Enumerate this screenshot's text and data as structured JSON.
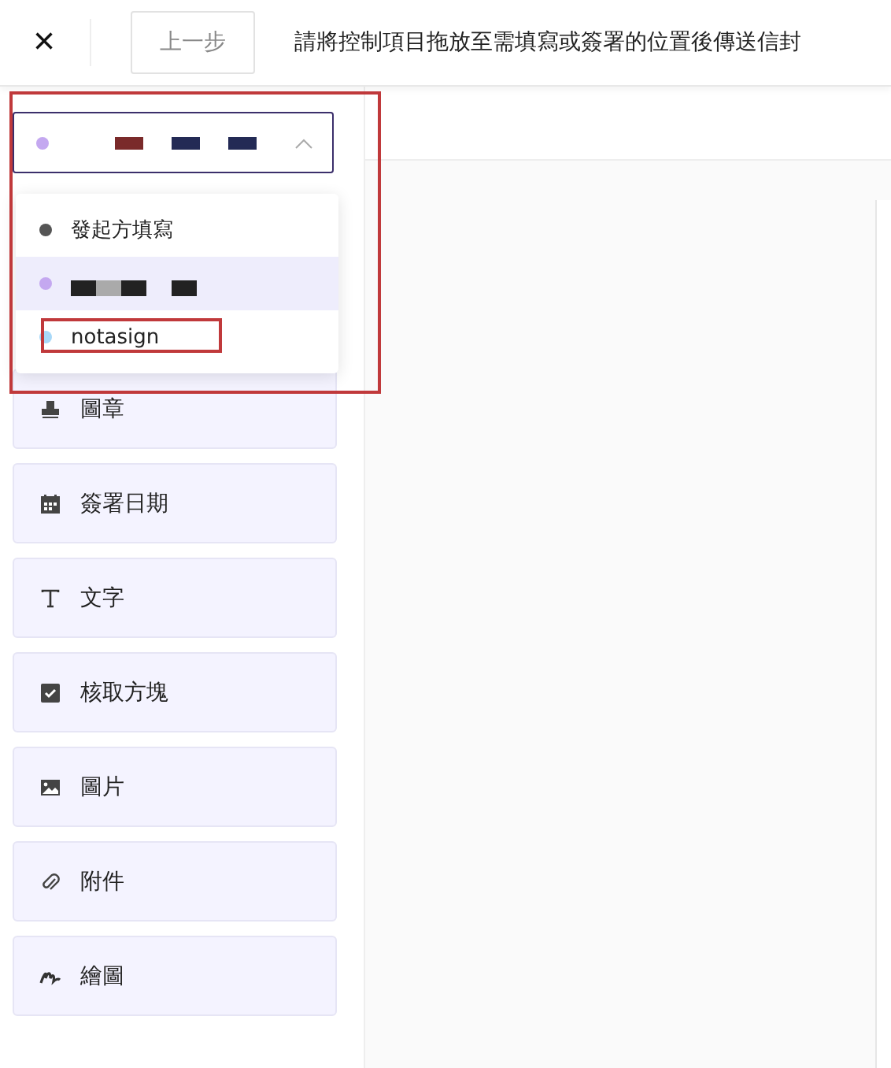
{
  "toolbar": {
    "close": "×",
    "back_button": "上一步",
    "instruction": "請將控制項目拖放至需填寫或簽署的位置後傳送信封"
  },
  "signer_select": {
    "color": "#c4a8f0",
    "expanded": true,
    "highlighted": true,
    "redactions": [
      {
        "color": "#7a2a2a"
      },
      {
        "color": "#232a55"
      },
      {
        "color": "#232a55"
      }
    ]
  },
  "signer_options": [
    {
      "kind": "text",
      "label": "發起方填寫",
      "color": "#555555",
      "selected": false,
      "highlighted": false
    },
    {
      "kind": "redacted",
      "color": "#c4a8f0",
      "selected": true,
      "highlighted": false
    },
    {
      "kind": "text",
      "label": "notasign",
      "color": "#a8d8f8",
      "selected": false,
      "highlighted": true
    }
  ],
  "fields": [
    {
      "kind": "stamp",
      "label": "圖章"
    },
    {
      "kind": "date",
      "label": "簽署日期"
    },
    {
      "kind": "text",
      "label": "文字"
    },
    {
      "kind": "checkbox",
      "label": "核取方塊"
    },
    {
      "kind": "image",
      "label": "圖片"
    },
    {
      "kind": "attachment",
      "label": "附件"
    },
    {
      "kind": "drawing",
      "label": "繪圖"
    }
  ]
}
